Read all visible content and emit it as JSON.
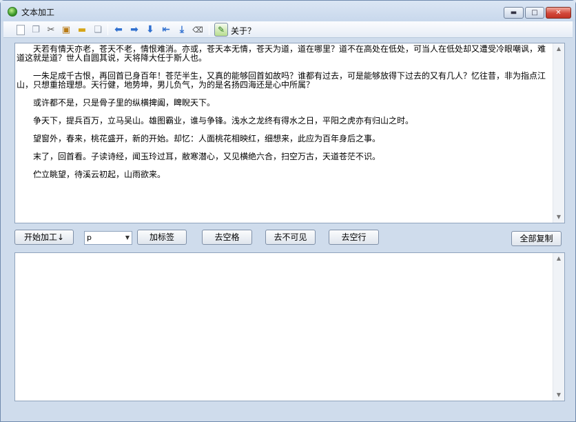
{
  "window": {
    "title": "文本加工",
    "minimize_glyph": "▬",
    "maximize_glyph": "□",
    "close_glyph": "✕"
  },
  "toolbar": {
    "about_label": "关于？",
    "icons": [
      "new-doc-icon",
      "copy-icon",
      "cut-icon",
      "paste-icon",
      "note-icon",
      "duplicate-icon",
      "arrow-left-icon",
      "arrow-right-icon",
      "arrow-down-icon",
      "arrow-first-icon",
      "arrow-download-icon",
      "erase-icon",
      "about-icon"
    ]
  },
  "input_text": {
    "paragraphs": [
      "天若有情天亦老，苍天不老，情恨难消。亦或，苍天本无情，苍天为道，道在哪里？道不在高处在低处，可当人在低处却又遭受冷眼嘲讽，难道这就是道？世人自圆其说，天将降大任于斯人也。",
      "一朱足成千古恨，再回首已身百年！苍茫半生，又真的能够回首如故吗？谁都有过去，可是能够放得下过去的又有几人？忆往昔，非为指点江山，只想重拾理想。天行健，地势坤，男儿负气，为的是名扬四海还是心中所属？",
      "或许都不是，只是骨子里的纵横捭阖，睥睨天下。",
      "争天下，提兵百万，立马吴山。雄图霸业，谁与争锋。浅水之龙终有得水之日，平阳之虎亦有归山之时。",
      "望窗外，春来，桃花盛开，新的开始。却忆：人面桃花相映红，细想来，此应为百年身后之事。",
      "末了，回首看。子读诗经，闻玉玲过耳，敝寒潜心，又见横绝六合，扫空万古，天道苍茫不识。",
      "伫立眺望，待溪云初起，山雨欲来。"
    ]
  },
  "actions": {
    "start_label": "开始加工↓",
    "tag_select_value": "p",
    "add_tag_label": "加标签",
    "remove_spaces_label": "去空格",
    "remove_invisible_label": "去不可见",
    "remove_blank_lines_label": "去空行",
    "copy_all_label": "全部复制"
  },
  "output_text": {
    "content": ""
  }
}
